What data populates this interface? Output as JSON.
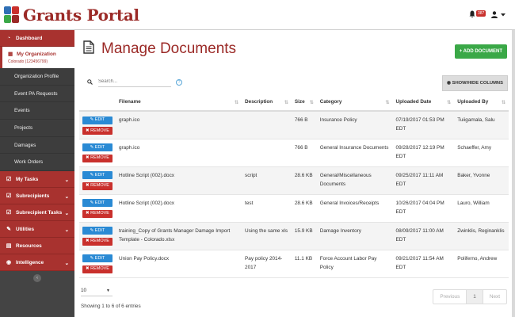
{
  "header": {
    "app_title": "Grants Portal",
    "notification_count": "387"
  },
  "sidebar": {
    "items": [
      {
        "label": "Dashboard",
        "icon": "dashboard-icon"
      },
      {
        "label": "My Organization",
        "sub": "Colorado (123456799)",
        "icon": "building-icon"
      },
      {
        "label": "Organization Profile"
      },
      {
        "label": "Event PA Requests"
      },
      {
        "label": "Events"
      },
      {
        "label": "Projects"
      },
      {
        "label": "Damages"
      },
      {
        "label": "Work Orders"
      },
      {
        "label": "My Tasks",
        "icon": "checkbox-icon"
      },
      {
        "label": "Subrecipients",
        "icon": "checkbox-icon"
      },
      {
        "label": "Subrecipient Tasks",
        "icon": "checkbox-icon"
      },
      {
        "label": "Utilities",
        "icon": "wrench-icon"
      },
      {
        "label": "Resources",
        "icon": "book-icon"
      },
      {
        "label": "Intelligence",
        "icon": "eye-icon"
      }
    ]
  },
  "main": {
    "page_title": "Manage Documents",
    "add_button": "+ ADD DOCUMENT",
    "search_placeholder": "Search...",
    "show_hide_button": "SHOW/HIDE COLUMNS",
    "columns": [
      "Filename",
      "Description",
      "Size",
      "Category",
      "Uploaded Date",
      "Uploaded By"
    ],
    "edit_label": "EDIT",
    "remove_label": "REMOVE",
    "rows": [
      {
        "filename": "graph.ico",
        "description": "",
        "size": "766 B",
        "category": "Insurance Policy",
        "date": "07/19/2017 01:53 PM EDT",
        "by": "Tuiigamala, Salu"
      },
      {
        "filename": "graph.ico",
        "description": "",
        "size": "766 B",
        "category": "General Insurance Documents",
        "date": "09/28/2017 12:19 PM EDT",
        "by": "Schaeffer, Amy"
      },
      {
        "filename": "Hotline Script (002).docx",
        "description": "script",
        "size": "28.6 KB",
        "category": "General/Miscellaneous Documents",
        "date": "09/25/2017 11:11 AM EDT",
        "by": "Baker, Yvonne"
      },
      {
        "filename": "Hotline Script (002).docx",
        "description": "test",
        "size": "28.6 KB",
        "category": "General Invoices/Receipts",
        "date": "10/26/2017 04:04 PM EDT",
        "by": "Lauro, William"
      },
      {
        "filename": "training_Copy of Grants Manager Damage Import Template - Colorado.xlsx",
        "description": "Using the same xls",
        "size": "15.9 KB",
        "category": "Damage Inventory",
        "date": "08/09/2017 11:00 AM EDT",
        "by": "Zwinklis, Reginanklis"
      },
      {
        "filename": "Union Pay Policy.docx",
        "description": "Pay policy 2014-2017",
        "size": "11.1 KB",
        "category": "Force Account Labor Pay Policy",
        "date": "09/21/2017 11:54 AM EDT",
        "by": "Poliferno, Andrew"
      }
    ],
    "page_length": "10",
    "info": "Showing 1 to 6 of 6 entries",
    "pager": {
      "prev": "Previous",
      "current": "1",
      "next": "Next"
    }
  },
  "colors": {
    "brand": "#9b2a27",
    "sidebar_red": "#a8322f",
    "add_green": "#3aa847",
    "edit_blue": "#2a8ad4",
    "remove_red": "#c9302c"
  }
}
